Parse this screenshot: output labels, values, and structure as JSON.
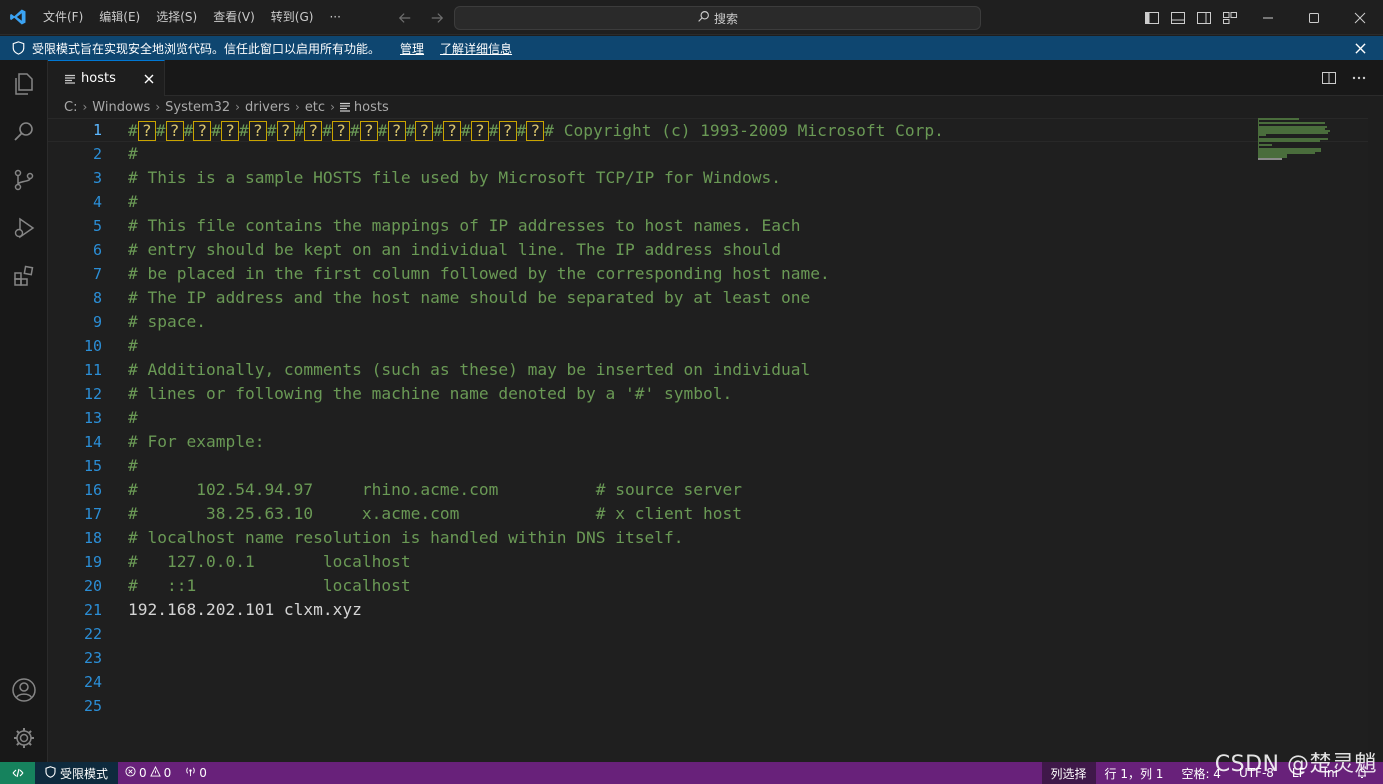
{
  "titlebar": {
    "menu": [
      "文件(F)",
      "编辑(E)",
      "选择(S)",
      "查看(V)",
      "转到(G)",
      "···"
    ],
    "search_label": "搜索"
  },
  "banner": {
    "message": "受限模式旨在实现安全地浏览代码。信任此窗口以启用所有功能。",
    "manage_link": "管理",
    "learn_more_link": "了解详细信息"
  },
  "tab": {
    "label": "hosts"
  },
  "breadcrumb": [
    "C:",
    "Windows",
    "System32",
    "drivers",
    "etc",
    "hosts"
  ],
  "editor": {
    "garbled_count": 15,
    "lines": [
      {
        "n": "1",
        "text": "# Copyright (c) 1993-2009 Microsoft Corp.",
        "kind": "comment"
      },
      {
        "n": "2",
        "text": "#",
        "kind": "comment"
      },
      {
        "n": "3",
        "text": "# This is a sample HOSTS file used by Microsoft TCP/IP for Windows.",
        "kind": "comment"
      },
      {
        "n": "4",
        "text": "#",
        "kind": "comment"
      },
      {
        "n": "5",
        "text": "# This file contains the mappings of IP addresses to host names. Each",
        "kind": "comment"
      },
      {
        "n": "6",
        "text": "# entry should be kept on an individual line. The IP address should",
        "kind": "comment"
      },
      {
        "n": "7",
        "text": "# be placed in the first column followed by the corresponding host name.",
        "kind": "comment"
      },
      {
        "n": "8",
        "text": "# The IP address and the host name should be separated by at least one",
        "kind": "comment"
      },
      {
        "n": "9",
        "text": "# space.",
        "kind": "comment"
      },
      {
        "n": "10",
        "text": "#",
        "kind": "comment"
      },
      {
        "n": "11",
        "text": "# Additionally, comments (such as these) may be inserted on individual",
        "kind": "comment"
      },
      {
        "n": "12",
        "text": "# lines or following the machine name denoted by a '#' symbol.",
        "kind": "comment"
      },
      {
        "n": "13",
        "text": "#",
        "kind": "comment"
      },
      {
        "n": "14",
        "text": "# For example:",
        "kind": "comment"
      },
      {
        "n": "15",
        "text": "#",
        "kind": "comment"
      },
      {
        "n": "16",
        "text": "#      102.54.94.97     rhino.acme.com          # source server",
        "kind": "comment"
      },
      {
        "n": "17",
        "text": "#       38.25.63.10     x.acme.com              # x client host",
        "kind": "comment"
      },
      {
        "n": "18",
        "text": "# localhost name resolution is handled within DNS itself.",
        "kind": "comment"
      },
      {
        "n": "19",
        "text": "#   127.0.0.1       localhost",
        "kind": "comment"
      },
      {
        "n": "20",
        "text": "#   ::1             localhost",
        "kind": "comment"
      },
      {
        "n": "21",
        "text": "192.168.202.101 clxm.xyz",
        "kind": "plain"
      },
      {
        "n": "22",
        "text": "",
        "kind": "plain"
      },
      {
        "n": "23",
        "text": "",
        "kind": "plain"
      },
      {
        "n": "24",
        "text": "",
        "kind": "plain"
      },
      {
        "n": "25",
        "text": "",
        "kind": "plain"
      }
    ]
  },
  "statusbar": {
    "restricted_mode": "受限模式",
    "errors": "0",
    "warnings": "0",
    "ports": "0",
    "column_select": "列选择",
    "cursor_position": "行 1，列 1",
    "indent": "空格: 4",
    "encoding": "UTF-8",
    "eol": "LF",
    "language": "Ini"
  },
  "watermark": "CSDN @楚灵魈",
  "colors": {
    "statusbar": "#68217a",
    "banner": "#0e4670",
    "comment": "#6a9955",
    "line_number": "#2b8ed6",
    "accent": "#0078d4"
  }
}
